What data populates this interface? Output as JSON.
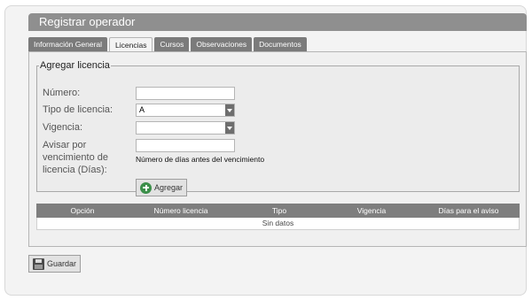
{
  "window": {
    "title": "Registrar operador"
  },
  "tabs": [
    {
      "label": "Información General",
      "active": false
    },
    {
      "label": "Licencias",
      "active": true
    },
    {
      "label": "Cursos",
      "active": false
    },
    {
      "label": "Observaciones",
      "active": false
    },
    {
      "label": "Documentos",
      "active": false
    }
  ],
  "form": {
    "legend": "Agregar licencia",
    "numero_label": "Número:",
    "numero_value": "",
    "tipo_label": "Tipo de licencia:",
    "tipo_value": "A",
    "vigencia_label": "Vigencia:",
    "vigencia_value": "",
    "aviso_label_1": "Avisar por",
    "aviso_label_2": "vencimiento de",
    "aviso_label_3": "licencia (Días):",
    "aviso_value": "",
    "aviso_hint": "Número de días antes del vencimiento",
    "add_button": "Agregar"
  },
  "table": {
    "columns": [
      "Opción",
      "Número licencia",
      "Tipo",
      "Vigencia",
      "Días para el aviso"
    ],
    "empty_text": "Sin datos"
  },
  "footer": {
    "save_button": "Guardar"
  },
  "icons": {
    "add": "plus-circle-icon",
    "save": "floppy-disk-icon",
    "dropdown": "chevron-down-icon"
  }
}
